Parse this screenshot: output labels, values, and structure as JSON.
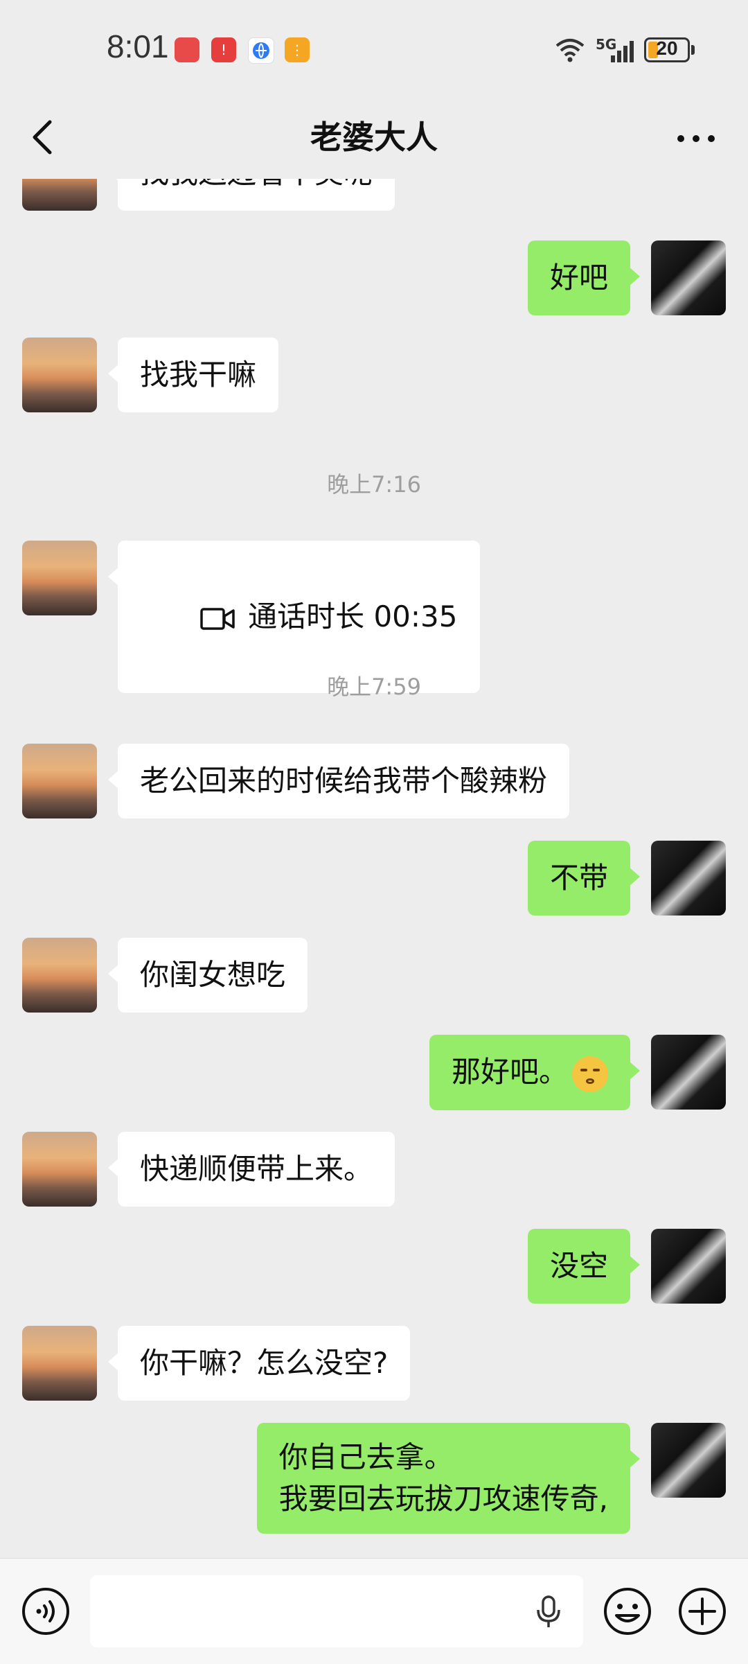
{
  "status": {
    "time": "8:01",
    "network": "5G",
    "battery": "20"
  },
  "header": {
    "title": "老婆大人"
  },
  "messages": {
    "m0": "找我这边看丨奖呢",
    "m1": "好吧",
    "m2": "找我干嘛",
    "ts1": "晚上7:16",
    "m3": "通话时长 00:35",
    "ts2": "晚上7:59",
    "m4": "老公回来的时候给我带个酸辣粉",
    "m5": "不带",
    "m6": "你闺女想吃",
    "m7": "那好吧。",
    "m8": "快递顺便带上来。",
    "m9": "没空",
    "m10": "你干嘛？怎么没空?",
    "m11": "你自己去拿。\n我要回去玩拔刀攻速传奇,"
  },
  "input": {
    "value": ""
  },
  "colors": {
    "my_bubble": "#95ec69",
    "their_bubble": "#ffffff",
    "background": "#ededed"
  }
}
